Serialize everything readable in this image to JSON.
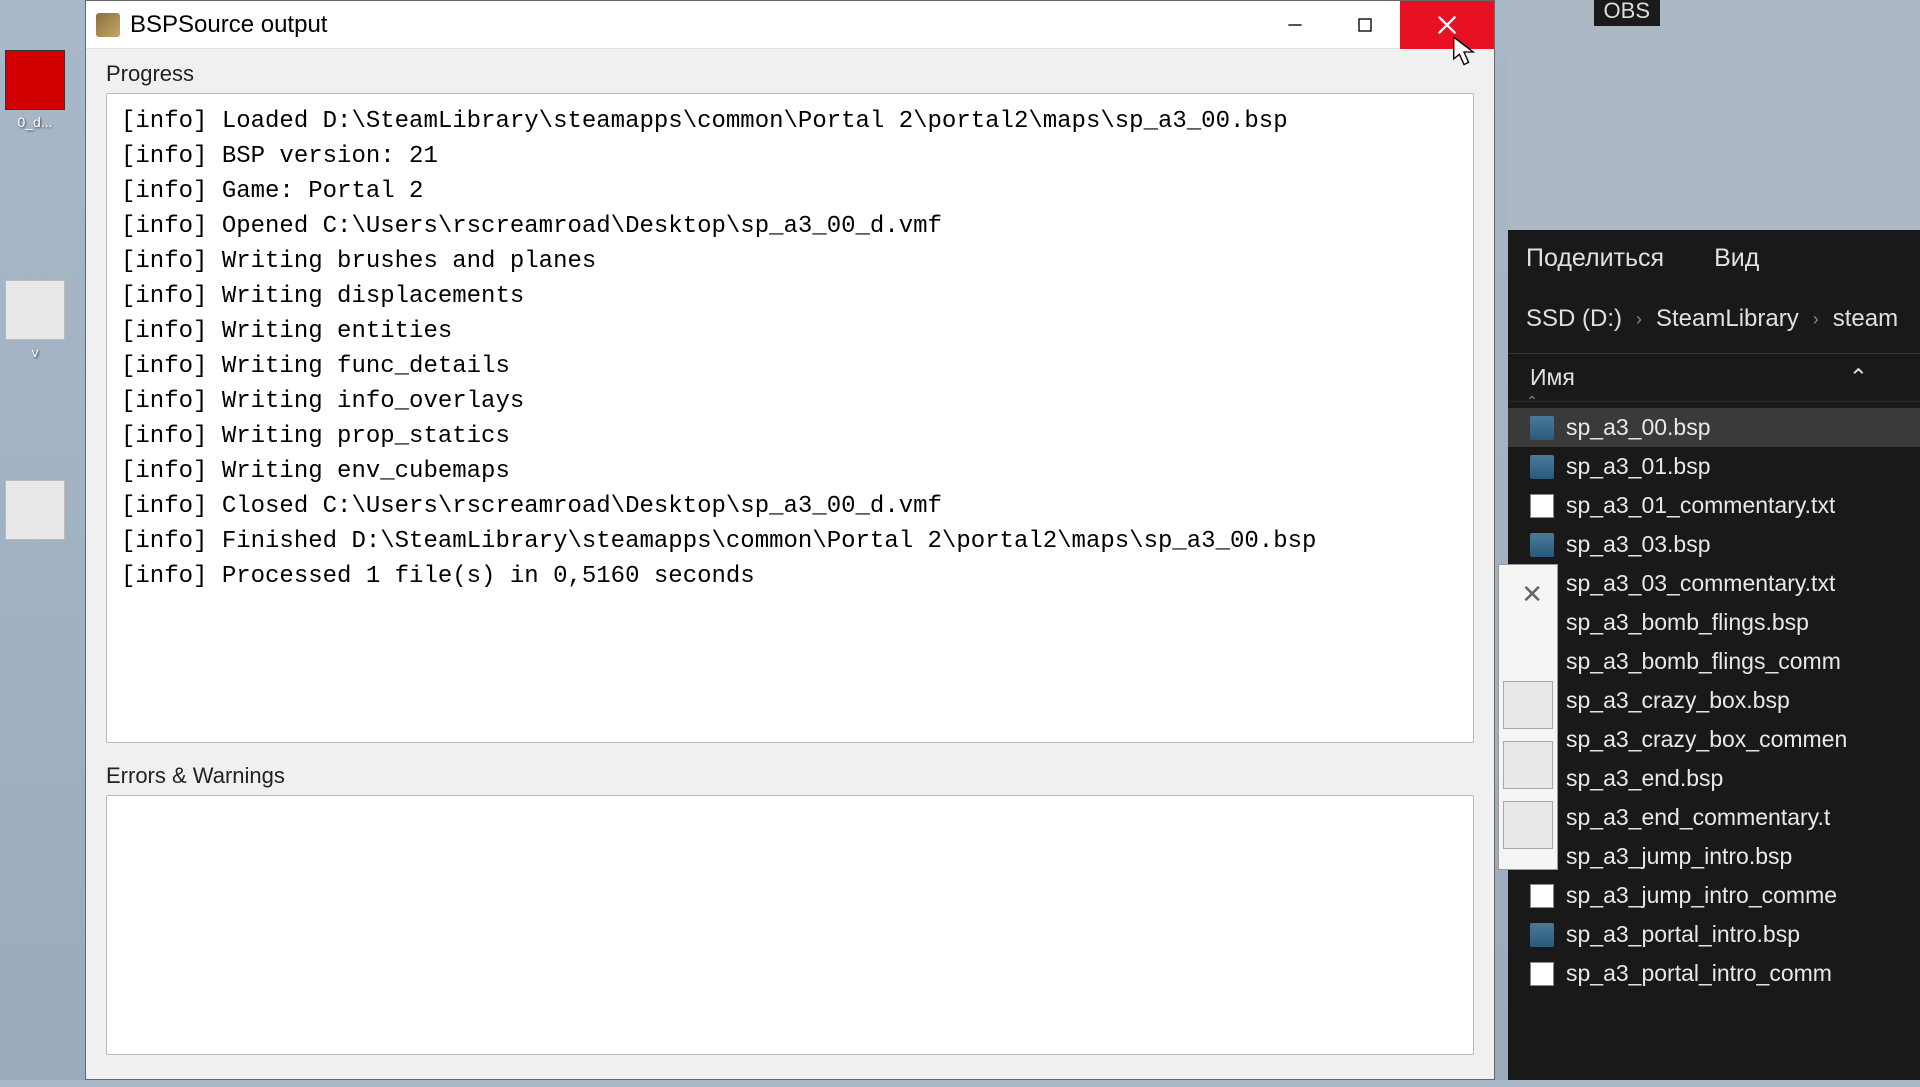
{
  "desktop": {
    "icon1_label": "0_d...",
    "icon2_label": "v"
  },
  "window": {
    "title": "BSPSource output",
    "progress_label": "Progress",
    "errors_label": "Errors & Warnings",
    "log_lines": [
      "[info] Loaded D:\\SteamLibrary\\steamapps\\common\\Portal 2\\portal2\\maps\\sp_a3_00.bsp",
      "[info] BSP version: 21",
      "[info] Game: Portal 2",
      "[info] Opened C:\\Users\\rscreamroad\\Desktop\\sp_a3_00_d.vmf",
      "[info] Writing brushes and planes",
      "[info] Writing displacements",
      "[info] Writing entities",
      "[info] Writing func_details",
      "[info] Writing info_overlays",
      "[info] Writing prop_statics",
      "[info] Writing env_cubemaps",
      "[info] Closed C:\\Users\\rscreamroad\\Desktop\\sp_a3_00_d.vmf",
      "[info] Finished D:\\SteamLibrary\\steamapps\\common\\Portal 2\\portal2\\maps\\sp_a3_00.bsp",
      "[info] Processed 1 file(s) in 0,5160 seconds"
    ]
  },
  "explorer": {
    "obs_label": "OBS",
    "toolbar": {
      "share": "Поделиться",
      "view": "Вид"
    },
    "breadcrumb": {
      "drive": "SSD (D:)",
      "folder1": "SteamLibrary",
      "folder2": "steam"
    },
    "column_name": "Имя",
    "files": [
      {
        "name": "sp_a3_00.bsp",
        "type": "bsp",
        "selected": true
      },
      {
        "name": "sp_a3_01.bsp",
        "type": "bsp"
      },
      {
        "name": "sp_a3_01_commentary.txt",
        "type": "txt"
      },
      {
        "name": "sp_a3_03.bsp",
        "type": "bsp"
      },
      {
        "name": "sp_a3_03_commentary.txt",
        "type": "txt"
      },
      {
        "name": "sp_a3_bomb_flings.bsp",
        "type": "bsp"
      },
      {
        "name": "sp_a3_bomb_flings_comm",
        "type": "txt"
      },
      {
        "name": "sp_a3_crazy_box.bsp",
        "type": "bsp"
      },
      {
        "name": "sp_a3_crazy_box_commen",
        "type": "txt"
      },
      {
        "name": "sp_a3_end.bsp",
        "type": "bsp"
      },
      {
        "name": "sp_a3_end_commentary.t",
        "type": "txt"
      },
      {
        "name": "sp_a3_jump_intro.bsp",
        "type": "bsp"
      },
      {
        "name": "sp_a3_jump_intro_comme",
        "type": "txt"
      },
      {
        "name": "sp_a3_portal_intro.bsp",
        "type": "bsp"
      },
      {
        "name": "sp_a3_portal_intro_comm",
        "type": "txt"
      }
    ]
  }
}
